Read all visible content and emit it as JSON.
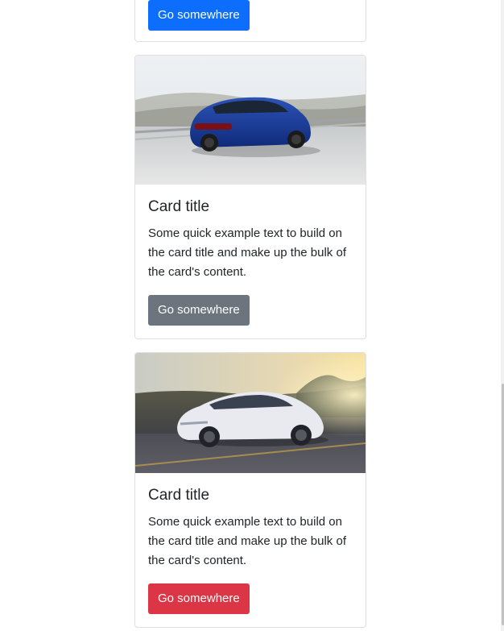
{
  "cards": [
    {
      "button_label": "Go somewhere",
      "button_color": "#0d6efd"
    },
    {
      "image_alt": "blue-car-photo",
      "title": "Card title",
      "text": "Some quick example text to build on the card title and make up the bulk of the card's content.",
      "button_label": "Go somewhere",
      "button_color": "#6c757d"
    },
    {
      "image_alt": "white-car-photo",
      "title": "Card title",
      "text": "Some quick example text to build on the card title and make up the bulk of the card's content.",
      "button_label": "Go somewhere",
      "button_color": "#dc3545"
    }
  ]
}
